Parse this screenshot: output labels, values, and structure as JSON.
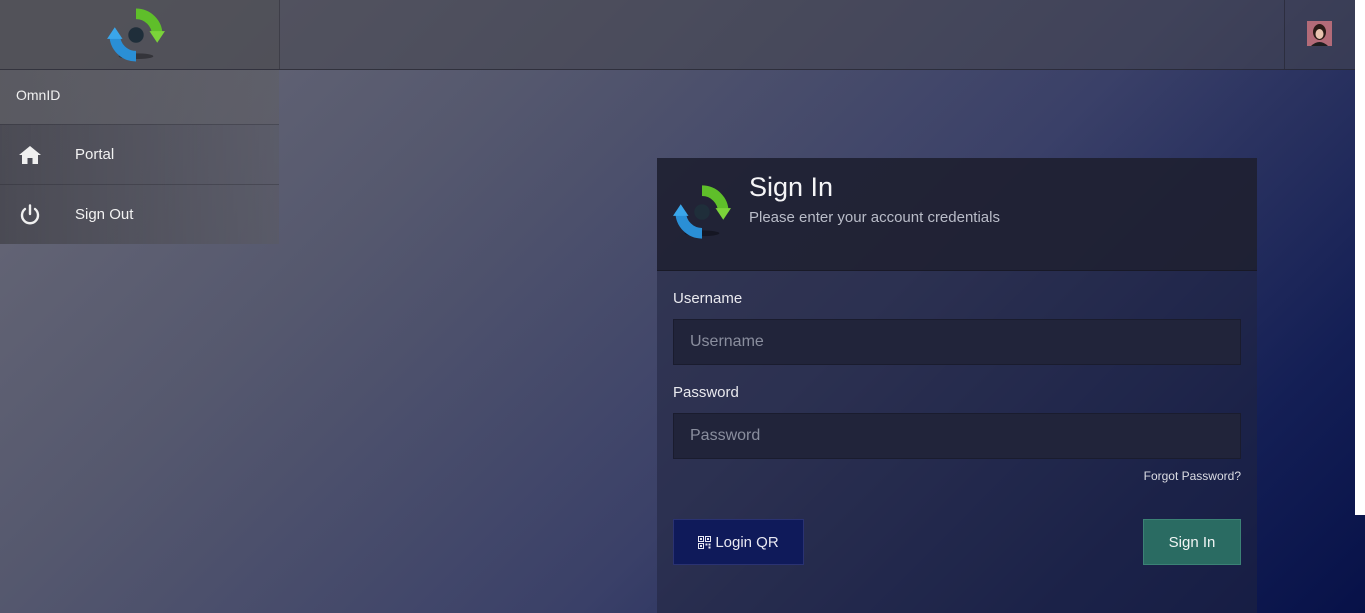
{
  "app": {
    "name": "OmnID"
  },
  "nav": {
    "items": [
      {
        "label": "Portal",
        "icon": "home-icon"
      },
      {
        "label": "Sign Out",
        "icon": "power-icon"
      }
    ]
  },
  "signin": {
    "title": "Sign In",
    "subtitle": "Please enter your account credentials",
    "username_label": "Username",
    "username_placeholder": "Username",
    "password_label": "Password",
    "password_placeholder": "Password",
    "forgot_label": "Forgot Password?",
    "qr_label": "Login QR",
    "submit_label": "Sign In"
  },
  "colors": {
    "accent": "#2a6b62",
    "qr_button": "#0f1a5a"
  }
}
